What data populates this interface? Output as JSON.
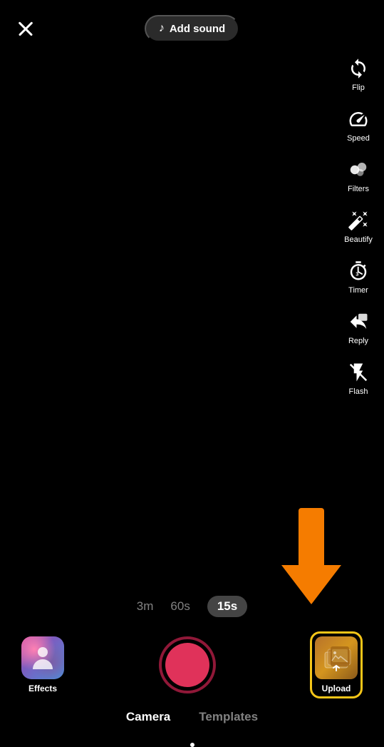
{
  "header": {
    "close_label": "×",
    "add_sound_label": "Add sound",
    "music_icon": "♪"
  },
  "sidebar": {
    "items": [
      {
        "id": "flip",
        "label": "Flip"
      },
      {
        "id": "speed",
        "label": "Speed"
      },
      {
        "id": "filters",
        "label": "Filters"
      },
      {
        "id": "beautify",
        "label": "Beautify"
      },
      {
        "id": "timer",
        "label": "Timer"
      },
      {
        "id": "reply",
        "label": "Reply"
      },
      {
        "id": "flash",
        "label": "Flash"
      }
    ]
  },
  "duration": {
    "options": [
      {
        "label": "3m",
        "active": false
      },
      {
        "label": "60s",
        "active": false
      },
      {
        "label": "15s",
        "active": true
      }
    ]
  },
  "controls": {
    "effects_label": "Effects",
    "upload_label": "Upload"
  },
  "tabs": [
    {
      "label": "Camera",
      "active": true
    },
    {
      "label": "Templates",
      "active": false
    }
  ]
}
